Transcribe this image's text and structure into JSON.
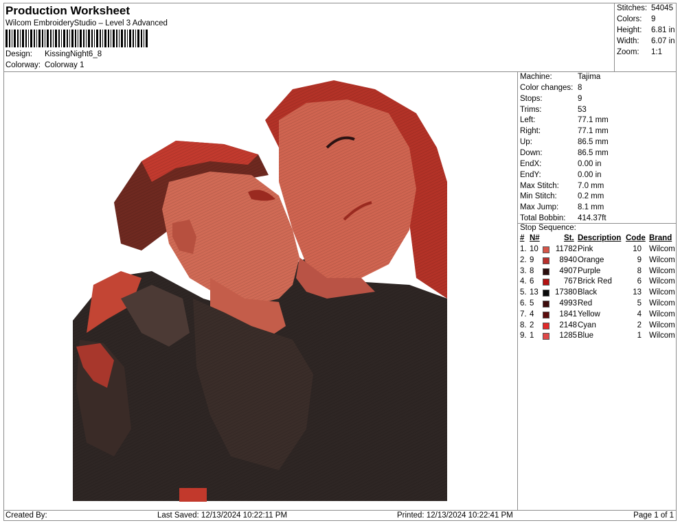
{
  "header": {
    "title": "Production Worksheet",
    "subtitle": "Wilcom EmbroideryStudio – Level 3 Advanced",
    "design_label": "Design:",
    "design_value": "KissingNight6_8",
    "colorway_label": "Colorway:",
    "colorway_value": "Colorway 1"
  },
  "stats": [
    {
      "k": "Stitches:",
      "v": "54045"
    },
    {
      "k": "Colors:",
      "v": "9"
    },
    {
      "k": "Height:",
      "v": "6.81 in"
    },
    {
      "k": "Width:",
      "v": "6.07 in"
    },
    {
      "k": "Zoom:",
      "v": "1:1"
    }
  ],
  "machine_info": [
    {
      "k": "Machine:",
      "v": "Tajima"
    },
    {
      "k": "Color changes:",
      "v": "8"
    },
    {
      "k": "Stops:",
      "v": "9"
    },
    {
      "k": "Trims:",
      "v": "53"
    },
    {
      "k": "Left:",
      "v": "77.1 mm"
    },
    {
      "k": "Right:",
      "v": "77.1 mm"
    },
    {
      "k": "Up:",
      "v": "86.5 mm"
    },
    {
      "k": "Down:",
      "v": "86.5 mm"
    },
    {
      "k": "EndX:",
      "v": "0.00 in"
    },
    {
      "k": "EndY:",
      "v": "0.00 in"
    },
    {
      "k": "Max Stitch:",
      "v": "7.0 mm"
    },
    {
      "k": "Min Stitch:",
      "v": "0.2 mm"
    },
    {
      "k": "Max Jump:",
      "v": "8.1 mm"
    },
    {
      "k": "Total Bobbin:",
      "v": "414.37ft"
    }
  ],
  "stop_sequence": {
    "title": "Stop Sequence:",
    "headers": {
      "idx": "#",
      "n": "N#",
      "st": "St.",
      "desc": "Description",
      "code": "Code",
      "brand": "Brand"
    },
    "rows": [
      {
        "idx": "1.",
        "n": "10",
        "color": "#d65548",
        "st": "11782",
        "desc": "Pink",
        "code": "10",
        "brand": "Wilcom"
      },
      {
        "idx": "2.",
        "n": "9",
        "color": "#b8302c",
        "st": "8940",
        "desc": "Orange",
        "code": "9",
        "brand": "Wilcom"
      },
      {
        "idx": "3.",
        "n": "8",
        "color": "#2a0d0d",
        "st": "4907",
        "desc": "Purple",
        "code": "8",
        "brand": "Wilcom"
      },
      {
        "idx": "4.",
        "n": "6",
        "color": "#b31111",
        "st": "767",
        "desc": "Brick Red",
        "code": "6",
        "brand": "Wilcom"
      },
      {
        "idx": "5.",
        "n": "13",
        "color": "#0a0a0a",
        "st": "17380",
        "desc": "Black",
        "code": "13",
        "brand": "Wilcom"
      },
      {
        "idx": "6.",
        "n": "5",
        "color": "#3d0c0c",
        "st": "4993",
        "desc": "Red",
        "code": "5",
        "brand": "Wilcom"
      },
      {
        "idx": "7.",
        "n": "4",
        "color": "#5c0d0d",
        "st": "1841",
        "desc": "Yellow",
        "code": "4",
        "brand": "Wilcom"
      },
      {
        "idx": "8.",
        "n": "2",
        "color": "#e02a2a",
        "st": "2148",
        "desc": "Cyan",
        "code": "2",
        "brand": "Wilcom"
      },
      {
        "idx": "9.",
        "n": "1",
        "color": "#e04848",
        "st": "1285",
        "desc": "Blue",
        "code": "1",
        "brand": "Wilcom"
      }
    ]
  },
  "footer": {
    "created_by": "Created By:",
    "last_saved": "Last Saved: 12/13/2024 10:22:11 PM",
    "printed": "Printed: 12/13/2024 10:22:41 PM",
    "page": "Page 1 of 1"
  }
}
